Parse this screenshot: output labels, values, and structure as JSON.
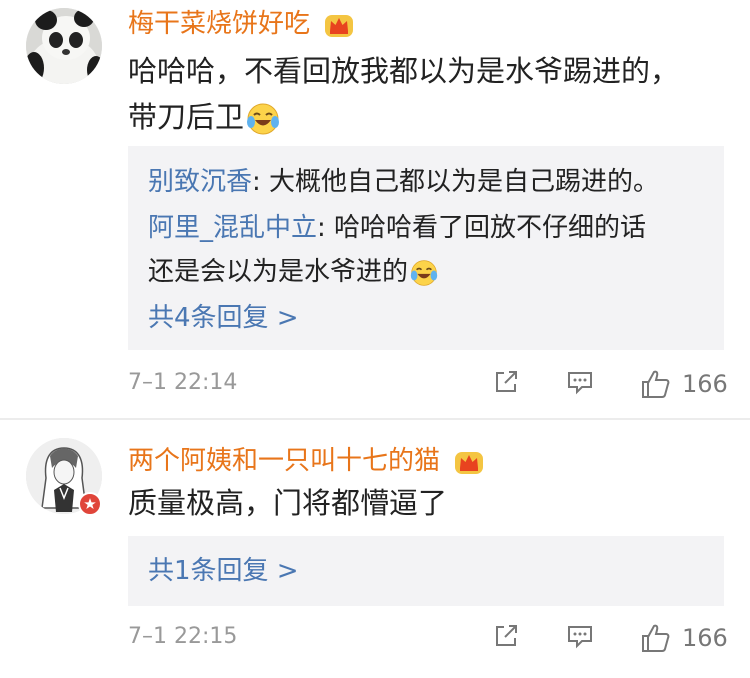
{
  "comments": [
    {
      "username": "梅干菜烧饼好吃",
      "content_lines": [
        "哈哈哈，不看回放我都以为是水爷踢进的，",
        "带刀后卫"
      ],
      "replies": [
        {
          "name": "别致沉香",
          "sep": ": ",
          "text": "大概他自己都以为是自己踢进的。"
        },
        {
          "name": "阿里_混乱中立",
          "sep": ": ",
          "text": "哈哈哈看了回放不仔细的话",
          "text2": "还是会以为是水爷进的"
        }
      ],
      "reply_more": "共4条回复 >",
      "time": "7–1 22:14",
      "likes": "166"
    },
    {
      "username": "两个阿姨和一只叫十七的猫",
      "content_lines": [
        "质量极高，门将都懵逼了"
      ],
      "reply_more": "共1条回复 >",
      "time": "7–1 22:15",
      "likes": "166"
    }
  ],
  "colors": {
    "username": "#e8751a",
    "reply_name": "#4a77b2",
    "reply_bg": "#f3f3f5",
    "meta": "#999999"
  },
  "icons": {
    "vip": "crown-icon",
    "laugh": "laughing-tears-emoji-icon",
    "share": "share-icon",
    "comment": "comment-icon",
    "like": "thumbs-up-icon",
    "badge": "verified-badge-icon"
  }
}
